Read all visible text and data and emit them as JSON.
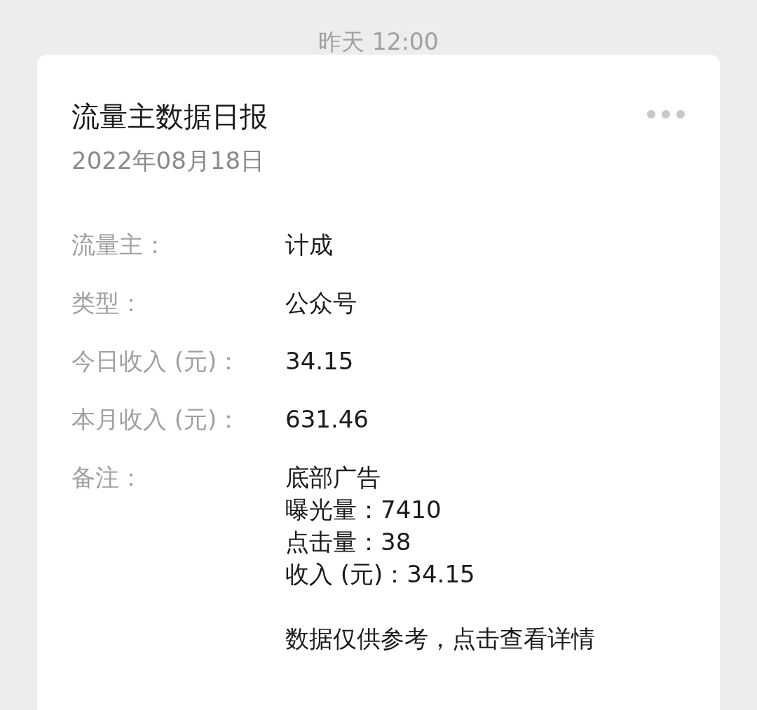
{
  "timestamp": "昨天 12:00",
  "card": {
    "title": "流量主数据日报",
    "date": "2022年08月18日",
    "fields": [
      {
        "label": "流量主：",
        "lines": [
          "计成"
        ]
      },
      {
        "label": "类型：",
        "lines": [
          "公众号"
        ]
      },
      {
        "label": "今日收入 (元)：",
        "lines": [
          "34.15"
        ]
      },
      {
        "label": "本月收入 (元)：",
        "lines": [
          "631.46"
        ]
      },
      {
        "label": "备注：",
        "lines": [
          "底部广告",
          "曝光量：7410",
          "点击量：38",
          "收入 (元)：34.15"
        ]
      }
    ],
    "footer": "数据仅供参考，点击查看详情"
  }
}
